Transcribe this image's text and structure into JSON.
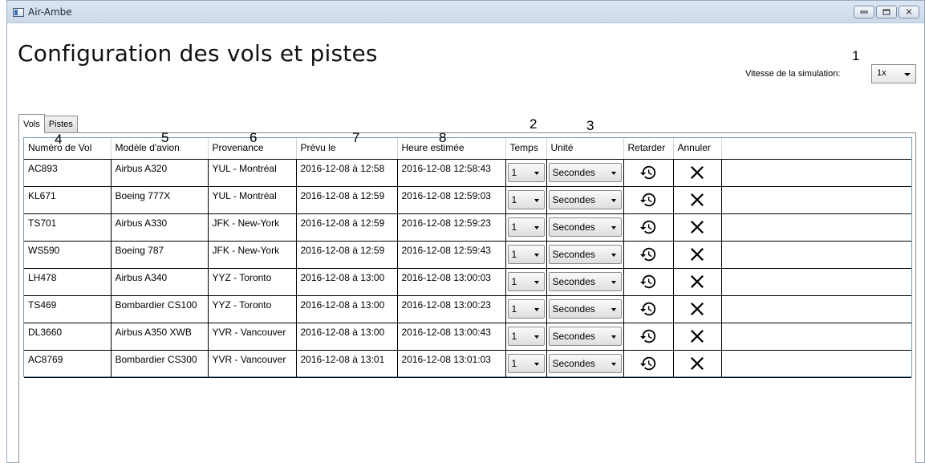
{
  "window": {
    "title": "Air-Ambe"
  },
  "page": {
    "title": "Configuration des vols et pistes"
  },
  "annotations": {
    "n1": "1",
    "n2": "2",
    "n3": "3",
    "n4": "4",
    "n5": "5",
    "n6": "6",
    "n7": "7",
    "n8": "8"
  },
  "simulation": {
    "speed_label": "Vitesse de la simulation:",
    "speed_value": "1x"
  },
  "tabs": [
    {
      "label": "Vols",
      "active": true
    },
    {
      "label": "Pistes",
      "active": false
    }
  ],
  "table": {
    "columns": [
      "Numéro de Vol",
      "Modèle d'avion",
      "Provenance",
      "Prévu le",
      "Heure estimée",
      "Temps",
      "Unité",
      "Retarder",
      "Annuler"
    ],
    "rows": [
      {
        "flight": "AC893",
        "model": "Airbus A320",
        "origin": "YUL - Montréal",
        "scheduled": "2016-12-08 à 12:58",
        "estimated": "2016-12-08 12:58:43",
        "time": "1",
        "unit": "Secondes"
      },
      {
        "flight": "KL671",
        "model": "Boeing 777X",
        "origin": "YUL - Montréal",
        "scheduled": "2016-12-08 à 12:59",
        "estimated": "2016-12-08 12:59:03",
        "time": "1",
        "unit": "Secondes"
      },
      {
        "flight": "TS701",
        "model": "Airbus A330",
        "origin": "JFK - New-York",
        "scheduled": "2016-12-08 à 12:59",
        "estimated": "2016-12-08 12:59:23",
        "time": "1",
        "unit": "Secondes"
      },
      {
        "flight": "WS590",
        "model": "Boeing 787",
        "origin": "JFK - New-York",
        "scheduled": "2016-12-08 à 12:59",
        "estimated": "2016-12-08 12:59:43",
        "time": "1",
        "unit": "Secondes"
      },
      {
        "flight": "LH478",
        "model": "Airbus A340",
        "origin": "YYZ - Toronto",
        "scheduled": "2016-12-08 à 13:00",
        "estimated": "2016-12-08 13:00:03",
        "time": "1",
        "unit": "Secondes"
      },
      {
        "flight": "TS469",
        "model": "Bombardier CS100",
        "origin": "YYZ - Toronto",
        "scheduled": "2016-12-08 à 13:00",
        "estimated": "2016-12-08 13:00:23",
        "time": "1",
        "unit": "Secondes"
      },
      {
        "flight": "DL3660",
        "model": "Airbus A350 XWB",
        "origin": "YVR - Vancouver",
        "scheduled": "2016-12-08 à 13:00",
        "estimated": "2016-12-08 13:00:43",
        "time": "1",
        "unit": "Secondes"
      },
      {
        "flight": "AC8769",
        "model": "Bombardier CS300",
        "origin": "YVR - Vancouver",
        "scheduled": "2016-12-08 à 13:01",
        "estimated": "2016-12-08 13:01:03",
        "time": "1",
        "unit": "Secondes"
      }
    ],
    "icons": {
      "delay": "history-icon",
      "cancel": "close-x-icon"
    }
  }
}
